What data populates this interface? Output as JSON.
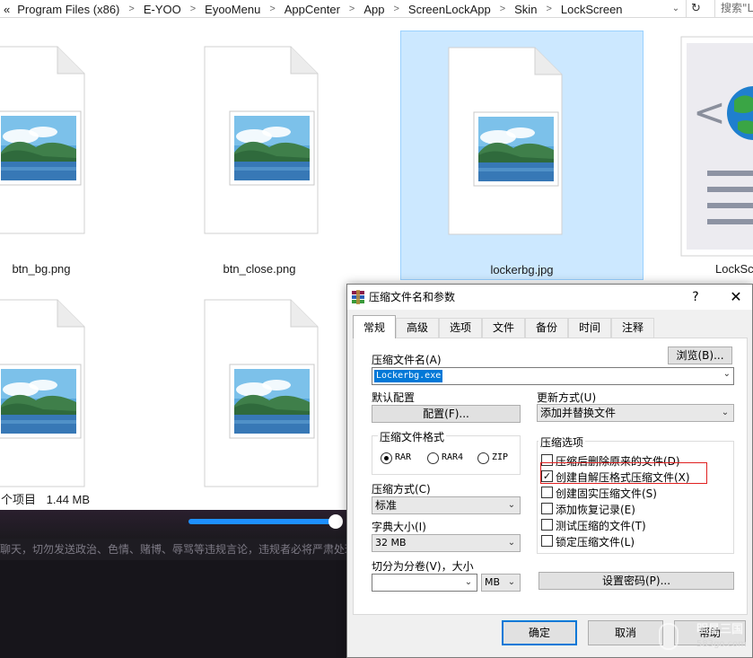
{
  "explorer": {
    "breadcrumb": [
      "Program Files (x86)",
      "E-YOO",
      "EyooMenu",
      "AppCenter",
      "App",
      "ScreenLockApp",
      "Skin",
      "LockScreen"
    ],
    "breadcrumb_overflow": "«",
    "search_placeholder": "搜索\"L",
    "files": [
      {
        "name": "btn_bg.png"
      },
      {
        "name": "btn_close.png"
      },
      {
        "name": "lockerbg.jpg",
        "selected": true
      },
      {
        "name": "LockScr"
      }
    ],
    "status": {
      "count_text": "个项目",
      "size_text": "1.44 MB"
    }
  },
  "app_strip": {
    "notice": "聊天，切勿发送政治、色情、赌博、辱骂等违规言论，违规者必将严肃处理"
  },
  "dialog": {
    "title": "压缩文件名和参数",
    "help": "?",
    "close": "✕",
    "tabs": [
      "常规",
      "高级",
      "选项",
      "文件",
      "备份",
      "时间",
      "注释"
    ],
    "active_tab": 0,
    "archive_name_label": "压缩文件名(A)",
    "archive_name_value": "Lockerbg.exe",
    "browse_label": "浏览(B)...",
    "default_profile_label": "默认配置",
    "profile_button": "配置(F)...",
    "update_mode_label": "更新方式(U)",
    "update_mode_value": "添加并替换文件",
    "format_group_title": "压缩文件格式",
    "formats": [
      {
        "label": "RAR",
        "checked": true
      },
      {
        "label": "RAR4",
        "checked": false
      },
      {
        "label": "ZIP",
        "checked": false
      }
    ],
    "options_group_title": "压缩选项",
    "options": [
      {
        "label": "压缩后删除原来的文件(D)",
        "checked": false
      },
      {
        "label": "创建自解压格式压缩文件(X)",
        "checked": true
      },
      {
        "label": "创建固实压缩文件(S)",
        "checked": false
      },
      {
        "label": "添加恢复记录(E)",
        "checked": false
      },
      {
        "label": "测试压缩的文件(T)",
        "checked": false
      },
      {
        "label": "锁定压缩文件(L)",
        "checked": false
      }
    ],
    "method_label": "压缩方式(C)",
    "method_value": "标准",
    "dict_label": "字典大小(I)",
    "dict_value": "32 MB",
    "split_label": "切分为分卷(V)，大小",
    "split_value": "",
    "split_unit": "MB",
    "password_button": "设置密码(P)...",
    "ok": "确定",
    "cancel": "取消",
    "help_button": "帮助"
  },
  "watermark": {
    "line1": "明星三国",
    "line2": "583go.com"
  }
}
